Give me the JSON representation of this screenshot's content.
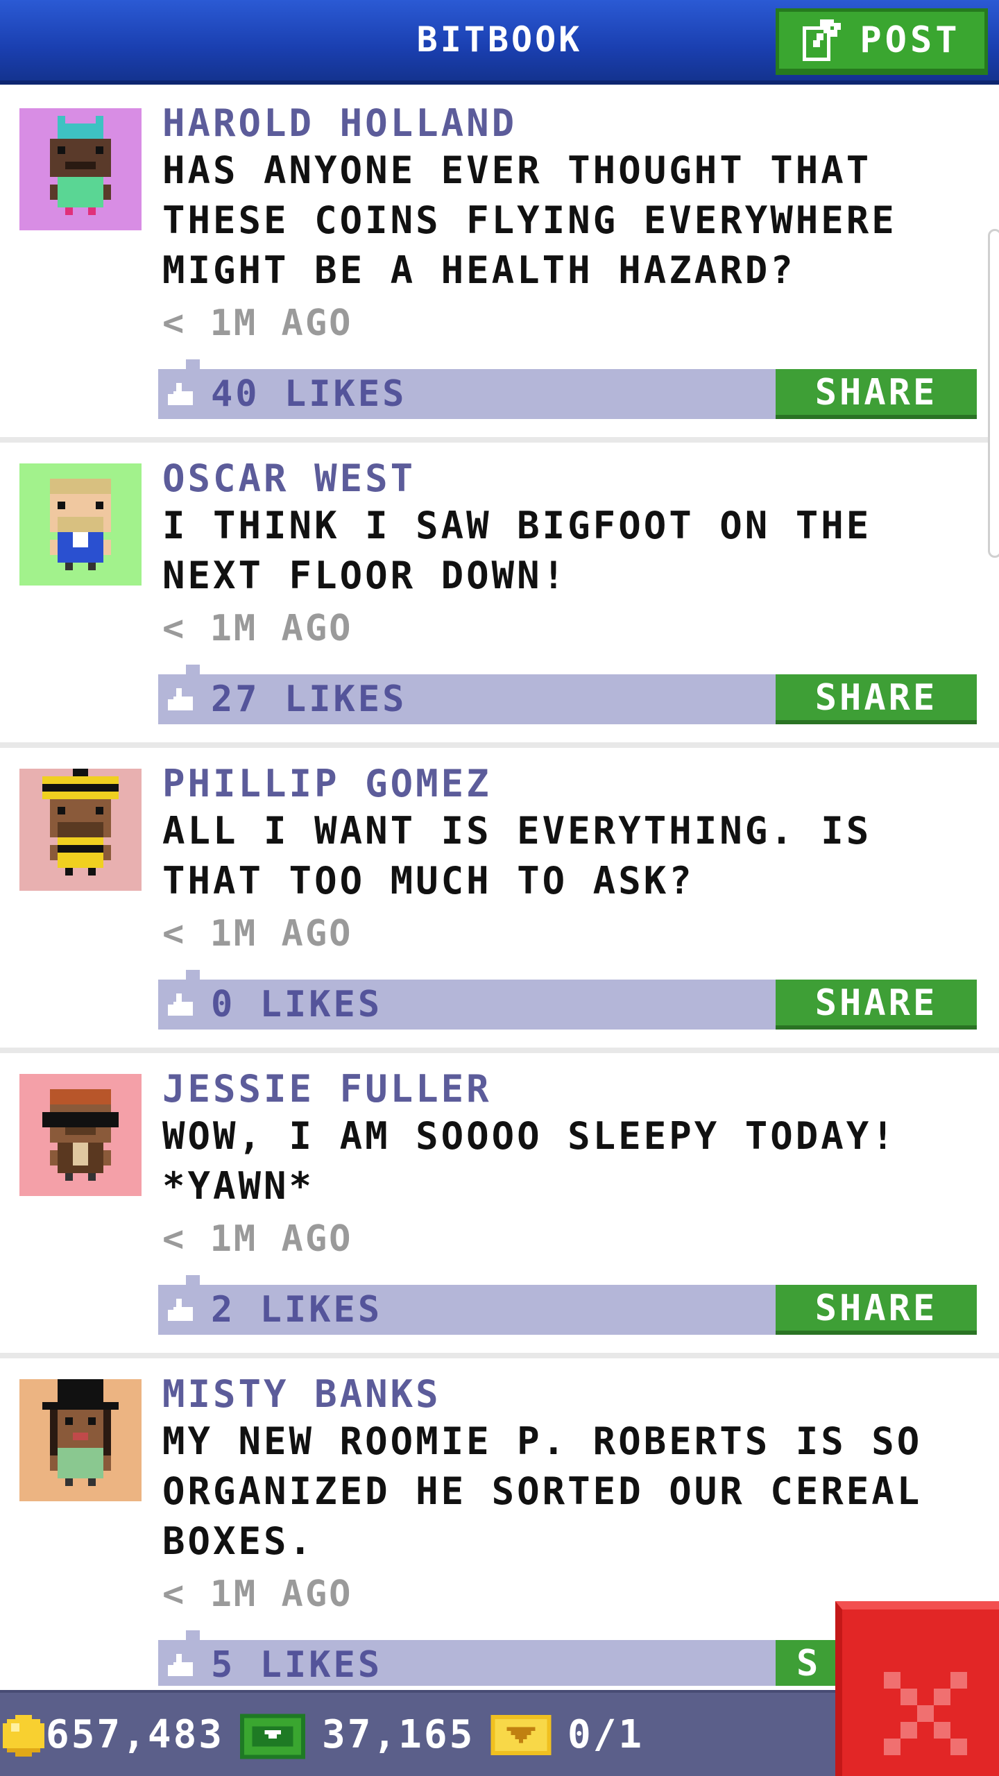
{
  "header": {
    "title": "BITBOOK",
    "post_label": "POST"
  },
  "posts": [
    {
      "author": "HAROLD HOLLAND",
      "message": "HAS ANYONE EVER THOUGHT THAT THESE COINS FLYING EVERYWHERE MIGHT BE A HEALTH HAZARD?",
      "timestamp": "< 1M AGO",
      "likes": "40 LIKES",
      "share_label": "SHARE",
      "avatar_bg": "#d88de4"
    },
    {
      "author": "OSCAR WEST",
      "message": "I THINK I SAW BIGFOOT ON THE NEXT FLOOR DOWN!",
      "timestamp": "< 1M AGO",
      "likes": "27 LIKES",
      "share_label": "SHARE",
      "avatar_bg": "#a2f28c"
    },
    {
      "author": "PHILLIP GOMEZ",
      "message": "ALL I WANT IS EVERYTHING. IS THAT TOO MUCH TO ASK?",
      "timestamp": "< 1M AGO",
      "likes": "0 LIKES",
      "share_label": "SHARE",
      "avatar_bg": "#e8b0b0"
    },
    {
      "author": "JESSIE FULLER",
      "message": "WOW, I AM SOOOO SLEEPY TODAY! *YAWN*",
      "timestamp": "< 1M AGO",
      "likes": "2 LIKES",
      "share_label": "SHARE",
      "avatar_bg": "#f4a0a8"
    },
    {
      "author": "MISTY BANKS",
      "message": "MY NEW ROOMIE P. ROBERTS IS SO ORGANIZED HE SORTED OUR CEREAL BOXES.",
      "timestamp": "< 1M AGO",
      "likes": "5 LIKES",
      "share_label": "S",
      "avatar_bg": "#ecb482"
    }
  ],
  "bottom_bar": {
    "coins": "657,483",
    "bux": "37,165",
    "tickets": "0/1"
  },
  "icons": {
    "post": "edit-icon",
    "like": "thumbs-up-icon",
    "coin": "coin-icon",
    "bux": "cash-icon",
    "ticket": "ticket-icon",
    "close": "close-icon"
  },
  "colors": {
    "header_blue": "#1a3fb0",
    "button_green": "#3e9f36",
    "likes_bar": "#b4b6d8",
    "author_text": "#5c5c9a",
    "close_red": "#e22626"
  }
}
